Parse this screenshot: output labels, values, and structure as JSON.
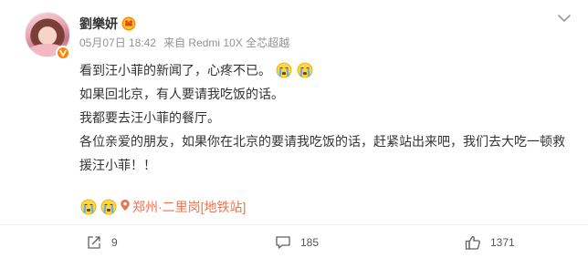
{
  "post": {
    "author": {
      "name": "劉樂妍",
      "avatar": "avatar",
      "vip_icon": "svip-crown-icon",
      "verified_icon": "verified-v-icon",
      "verified_color": "#ff8200"
    },
    "time": "05月07日 18:42",
    "source": "来自 Redmi 10X 全芯超越",
    "more_icon": "chevron-down-icon",
    "lines": [
      "看到汪小菲的新闻了，心疼不已。",
      "如果回北京，有人要请我吃饭的话。",
      "我都要去汪小菲的餐厅。",
      "各位亲爱的朋友，如果你在北京的要请我吃饭的话，赶紧站出来吧，我们去大吃一顿救援汪小菲！！"
    ],
    "emojis": [
      "crying-face-icon",
      "crying-face-icon"
    ],
    "location_emojis": [
      "crying-face-icon",
      "crying-face-icon"
    ],
    "location": "郑州·二里岗[地铁站]",
    "location_icon": "location-pin-icon",
    "accent_color": "#eb7350"
  },
  "actions": {
    "repost": {
      "icon": "share-icon",
      "count": "9"
    },
    "comment": {
      "icon": "comment-icon",
      "count": "185"
    },
    "like": {
      "icon": "thumbs-up-icon",
      "count": "1371"
    }
  }
}
